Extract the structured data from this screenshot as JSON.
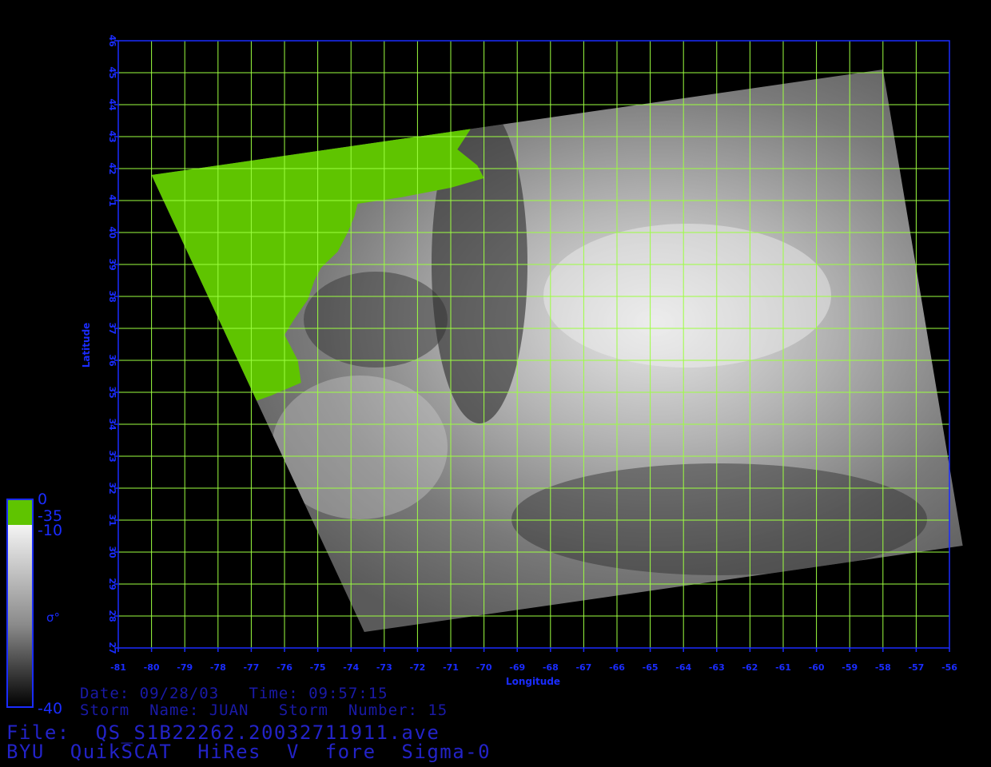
{
  "map": {
    "latitude_label": "Latitude",
    "longitude_label": "Longitude",
    "lat_range": [
      27,
      46
    ],
    "lon_range": [
      -81,
      -56
    ],
    "lat_ticks": [
      "27",
      "28",
      "29",
      "30",
      "31",
      "32",
      "33",
      "34",
      "35",
      "36",
      "37",
      "38",
      "39",
      "40",
      "41",
      "42",
      "43",
      "44",
      "45",
      "46"
    ],
    "lon_ticks": [
      "-81",
      "-80",
      "-79",
      "-78",
      "-77",
      "-76",
      "-75",
      "-74",
      "-73",
      "-72",
      "-71",
      "-70",
      "-69",
      "-68",
      "-67",
      "-66",
      "-65",
      "-64",
      "-63",
      "-62",
      "-61",
      "-60",
      "-59",
      "-58",
      "-57",
      "-56"
    ],
    "grid_color": "#9cff40",
    "axis_color": "#1a2cff",
    "land_color": "#5fc400",
    "swath_corners": {
      "nw": {
        "lon": -80,
        "lat": 41.8
      },
      "ne": {
        "lon": -58,
        "lat": 45.1
      },
      "se": {
        "lon": -55.6,
        "lat": 30.2
      },
      "sw": {
        "lon": -73.6,
        "lat": 27.5
      }
    }
  },
  "colorbar": {
    "label_top": "0",
    "label_land": "-35",
    "label_high": "-10",
    "label_bottom": "-40",
    "symbol": "σ°",
    "land_color": "#5fc400"
  },
  "info": {
    "date_line": "Date: 09/28/03   Time: 09:57:15",
    "storm_line": "Storm  Name: JUAN   Storm  Number: 15",
    "file_line": "File:  QS_S1B22262.20032711911.ave",
    "title_line": "BYU  QuikSCAT  HiRes  V  fore  Sigma-0"
  }
}
